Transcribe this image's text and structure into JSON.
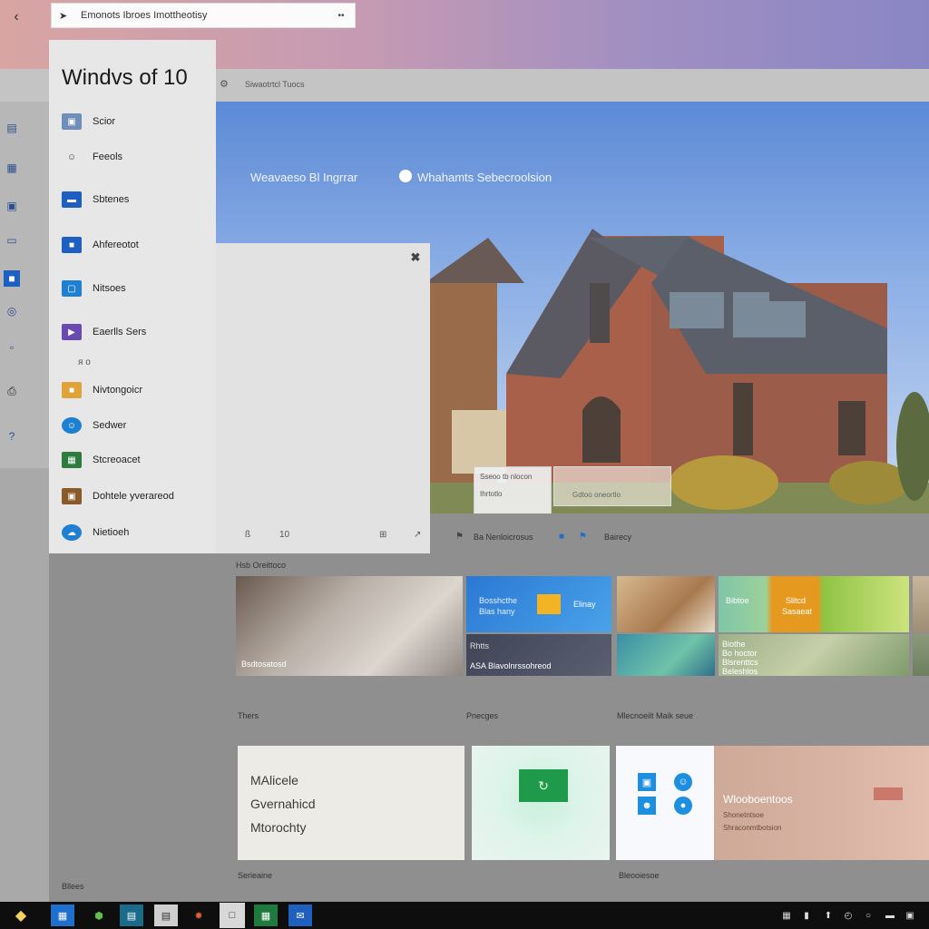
{
  "browser": {
    "back_icon": "back-arrow-icon",
    "address_text": "Emonots Ibroes Imottheotisy",
    "menu_icon": "ellipsis-icon",
    "toolbar_text": "Siwaotrtcl Tuocs"
  },
  "start_menu": {
    "title": "Windvs of 10",
    "items": [
      {
        "label": "Scior",
        "icon": "photos-icon",
        "color": "#6f8fb8"
      },
      {
        "label": "Feeols",
        "icon": "people-icon",
        "color": "#444444"
      },
      {
        "label": "Sbtenes",
        "icon": "tablet-icon",
        "color": "#1f5fbf"
      },
      {
        "label": "Ahfereotot",
        "icon": "store-icon",
        "color": "#1f5fbf"
      },
      {
        "label": "Nitsoes",
        "icon": "window-icon",
        "color": "#1f7fd0"
      },
      {
        "label": "Eaerlls Sers",
        "icon": "media-icon",
        "color": "#6a4ab0"
      },
      {
        "label": "Nivtongoicr",
        "icon": "folder-icon",
        "color": "#e0a23a"
      },
      {
        "label": "Sedwer",
        "icon": "person-icon",
        "color": "#1f7fd0"
      },
      {
        "label": "Stcreoacet",
        "icon": "excel-icon",
        "color": "#2f7a3f"
      },
      {
        "label": "Dohtele yverareod",
        "icon": "camera-icon",
        "color": "#8a5a2a"
      },
      {
        "label": "Nietioeh",
        "icon": "onedrive-icon",
        "color": "#1f7fd0"
      }
    ],
    "sub_text": "ᴙ   ᴏ",
    "footer": [
      "ß",
      "10",
      "⊞",
      "↗"
    ]
  },
  "hero": {
    "title": "Weavaeso Bl Ingrrar",
    "radio_label": "Whahamts Sebecroolsion",
    "popup_line1": "Sseoo tb nlocon",
    "popup_line2": "Ihrtotlo",
    "popup_bar_text": "Gdtoo oneortlo",
    "under_texts": [
      "Ba Nenloicrosus",
      "Bairecy"
    ]
  },
  "sections": {
    "row1_label": "Hsb Oreittoco",
    "row1_captions": [
      "Thers",
      "Pnecges",
      "Mlecnoeilt Maik seue"
    ],
    "row2_captions": [
      "Serieaine",
      "Bleooiesoe"
    ],
    "bottom_left": "Bllees"
  },
  "tiles": {
    "room_caption": "Bsdtosatosd",
    "blue_line1": "Bosshcthe",
    "blue_line2": "Blas hany",
    "blue_right": "Elinay",
    "dark_caption": "ASA Blavolnrssohreod",
    "dark_label": "Rhtts",
    "green_text1": "Bibtoe",
    "green_text2": "Slitcd",
    "green_text3": "Sasaeat",
    "meadow_lines": [
      "Blothe",
      "Bo hoctor",
      "Blsrenttcs",
      "Beleshlos"
    ],
    "paper_lines": [
      "MAlicele",
      "Gvernahicd",
      "Mtorochty"
    ],
    "salmon_title": "Wlooboentoos",
    "salmon_line1": "Shonetntsoe",
    "salmon_line2": "Shraconmtbotsion"
  },
  "taskbar": {
    "apps": [
      "calendar-app-icon",
      "xbox-app-icon",
      "news-app-icon",
      "notes-app-icon",
      "groove-app-icon",
      "files-app-icon",
      "excel-app-icon",
      "outlook-app-icon"
    ],
    "tray": [
      "network-icon",
      "battery-icon",
      "sync-icon",
      "clock-icon",
      "notification-icon",
      "keyboard-icon",
      "action-center-icon"
    ]
  }
}
